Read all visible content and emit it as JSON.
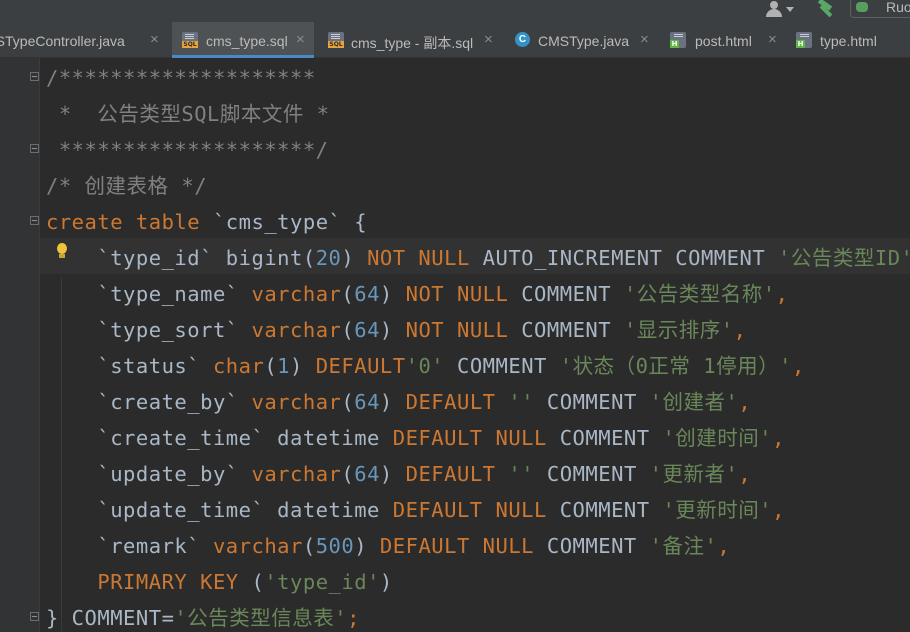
{
  "toolbar": {
    "run_config_label": "Ruo"
  },
  "tabs": [
    {
      "label": "MSTypeController.java",
      "icon": "java-class-icon",
      "active": false
    },
    {
      "label": "cms_type.sql",
      "icon": "sql-file-icon",
      "active": true
    },
    {
      "label": "cms_type - 副本.sql",
      "icon": "sql-file-icon",
      "active": false
    },
    {
      "label": "CMSType.java",
      "icon": "java-class-icon",
      "active": false
    },
    {
      "label": "post.html",
      "icon": "html-file-icon",
      "active": false
    },
    {
      "label": "type.html",
      "icon": "html-file-icon",
      "active": false
    }
  ],
  "tab_close_glyph": "×",
  "class_icon_letter": "C",
  "sql_icon_text": "SQL",
  "html_icon_text": "H",
  "colors": {
    "keyword": "#cc7832",
    "comment": "#808080",
    "number": "#6897bb",
    "string": "#6a8759",
    "default_text": "#a9b7c6",
    "active_tab_underline": "#4a88c7"
  },
  "code_lines": [
    [
      {
        "t": "/********************",
        "c": "cm"
      }
    ],
    [
      {
        "t": " *  公告类型SQL脚本文件 *",
        "c": "cm"
      }
    ],
    [
      {
        "t": " ********************/",
        "c": "cm"
      }
    ],
    [
      {
        "t": "/* 创建表格 */",
        "c": "cm"
      }
    ],
    [
      {
        "t": "create table ",
        "c": "kw"
      },
      {
        "t": "`cms_type`",
        "c": "id"
      },
      {
        "t": " {",
        "c": "pl"
      }
    ],
    [
      {
        "t": "    `type_id` bigint(",
        "c": "pl"
      },
      {
        "t": "20",
        "c": "num"
      },
      {
        "t": ") ",
        "c": "pl"
      },
      {
        "t": "NOT NULL",
        "c": "kw"
      },
      {
        "t": " AUTO_INCREMENT COMMENT ",
        "c": "pl"
      },
      {
        "t": "'公告类型ID'",
        "c": "str"
      }
    ],
    [
      {
        "t": "    `type_name` ",
        "c": "pl"
      },
      {
        "t": "varchar",
        "c": "kw"
      },
      {
        "t": "(",
        "c": "pl"
      },
      {
        "t": "64",
        "c": "num"
      },
      {
        "t": ") ",
        "c": "pl"
      },
      {
        "t": "NOT NULL",
        "c": "kw"
      },
      {
        "t": " COMMENT ",
        "c": "pl"
      },
      {
        "t": "'公告类型名称'",
        "c": "str"
      },
      {
        "t": ",",
        "c": "kw"
      }
    ],
    [
      {
        "t": "    `type_sort` ",
        "c": "pl"
      },
      {
        "t": "varchar",
        "c": "kw"
      },
      {
        "t": "(",
        "c": "pl"
      },
      {
        "t": "64",
        "c": "num"
      },
      {
        "t": ") ",
        "c": "pl"
      },
      {
        "t": "NOT NULL",
        "c": "kw"
      },
      {
        "t": " COMMENT ",
        "c": "pl"
      },
      {
        "t": "'显示排序'",
        "c": "str"
      },
      {
        "t": ",",
        "c": "kw"
      }
    ],
    [
      {
        "t": "    `status` ",
        "c": "pl"
      },
      {
        "t": "char",
        "c": "kw"
      },
      {
        "t": "(",
        "c": "pl"
      },
      {
        "t": "1",
        "c": "num"
      },
      {
        "t": ") ",
        "c": "pl"
      },
      {
        "t": "DEFAULT",
        "c": "kw"
      },
      {
        "t": "'0'",
        "c": "str"
      },
      {
        "t": " COMMENT ",
        "c": "pl"
      },
      {
        "t": "'状态（0正常 1停用）'",
        "c": "str"
      },
      {
        "t": ",",
        "c": "kw"
      }
    ],
    [
      {
        "t": "    `create_by` ",
        "c": "pl"
      },
      {
        "t": "varchar",
        "c": "kw"
      },
      {
        "t": "(",
        "c": "pl"
      },
      {
        "t": "64",
        "c": "num"
      },
      {
        "t": ") ",
        "c": "pl"
      },
      {
        "t": "DEFAULT",
        "c": "kw"
      },
      {
        "t": " ",
        "c": "pl"
      },
      {
        "t": "''",
        "c": "str"
      },
      {
        "t": " COMMENT ",
        "c": "pl"
      },
      {
        "t": "'创建者'",
        "c": "str"
      },
      {
        "t": ",",
        "c": "kw"
      }
    ],
    [
      {
        "t": "    `create_time` datetime ",
        "c": "pl"
      },
      {
        "t": "DEFAULT NULL",
        "c": "kw"
      },
      {
        "t": " COMMENT ",
        "c": "pl"
      },
      {
        "t": "'创建时间'",
        "c": "str"
      },
      {
        "t": ",",
        "c": "kw"
      }
    ],
    [
      {
        "t": "    `update_by` ",
        "c": "pl"
      },
      {
        "t": "varchar",
        "c": "kw"
      },
      {
        "t": "(",
        "c": "pl"
      },
      {
        "t": "64",
        "c": "num"
      },
      {
        "t": ") ",
        "c": "pl"
      },
      {
        "t": "DEFAULT",
        "c": "kw"
      },
      {
        "t": " ",
        "c": "pl"
      },
      {
        "t": "''",
        "c": "str"
      },
      {
        "t": " COMMENT ",
        "c": "pl"
      },
      {
        "t": "'更新者'",
        "c": "str"
      },
      {
        "t": ",",
        "c": "kw"
      }
    ],
    [
      {
        "t": "    `update_time` datetime ",
        "c": "pl"
      },
      {
        "t": "DEFAULT NULL",
        "c": "kw"
      },
      {
        "t": " COMMENT ",
        "c": "pl"
      },
      {
        "t": "'更新时间'",
        "c": "str"
      },
      {
        "t": ",",
        "c": "kw"
      }
    ],
    [
      {
        "t": "    `remark` ",
        "c": "pl"
      },
      {
        "t": "varchar",
        "c": "kw"
      },
      {
        "t": "(",
        "c": "pl"
      },
      {
        "t": "500",
        "c": "num"
      },
      {
        "t": ") ",
        "c": "pl"
      },
      {
        "t": "DEFAULT NULL",
        "c": "kw"
      },
      {
        "t": " COMMENT ",
        "c": "pl"
      },
      {
        "t": "'备注'",
        "c": "str"
      },
      {
        "t": ",",
        "c": "kw"
      }
    ],
    [
      {
        "t": "    PRIMARY KEY ",
        "c": "kw"
      },
      {
        "t": "(",
        "c": "pl"
      },
      {
        "t": "'type_id'",
        "c": "str"
      },
      {
        "t": ")",
        "c": "pl"
      }
    ],
    [
      {
        "t": "} COMMENT=",
        "c": "pl"
      },
      {
        "t": "'公告类型信息表'",
        "c": "str"
      },
      {
        "t": ";",
        "c": "kw"
      }
    ]
  ]
}
